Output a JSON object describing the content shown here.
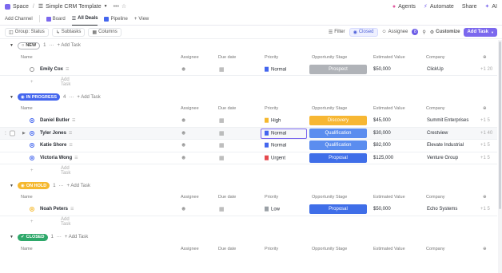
{
  "breadcrumb": {
    "space": "Space",
    "list": "Simple CRM Template",
    "more": "•••",
    "star": "☆"
  },
  "topbar": {
    "agents": "Agents",
    "automate": "Automate",
    "share": "Share",
    "ai": "AI"
  },
  "views": {
    "add_channel": "Add Channel",
    "board": "Board",
    "all_deals": "All Deals",
    "pipeline": "Pipeline",
    "add_view": "View"
  },
  "toolbar": {
    "group": "Group: Status",
    "subtasks": "Subtasks",
    "columns": "Columns",
    "filter": "Filter",
    "closed": "Closed",
    "assignee": "Assignee",
    "assignee_count": "8",
    "customize": "Customize",
    "add_task": "Add Task"
  },
  "columns": {
    "name": "Name",
    "assignee": "Assignee",
    "due": "Due date",
    "priority": "Priority",
    "stage": "Opportunity Stage",
    "estimated": "Estimated Value",
    "company": "Company"
  },
  "add_task_label": "Add Task",
  "colors": {
    "accent": "#7b68ee",
    "new": "#b0b3b8",
    "in_progress": "#4466ee",
    "on_hold": "#f5b82e",
    "closed": "#2ea86a"
  },
  "groups": [
    {
      "label": "NEW",
      "count": "1",
      "add": "+ Add Task",
      "rows": [
        {
          "name": "Emily Cox",
          "priority": "Normal",
          "stage": "Prospect",
          "estimated": "$50,000",
          "company": "ClickUp",
          "extra": "+1 20"
        }
      ]
    },
    {
      "label": "IN PROGRESS",
      "count": "4",
      "add": "+ Add Task",
      "rows": [
        {
          "name": "Daniel Butler",
          "priority": "High",
          "stage": "Discovery",
          "estimated": "$45,000",
          "company": "Summit Enterprises",
          "extra": "+1 5"
        },
        {
          "name": "Tyler Jones",
          "priority": "Normal",
          "stage": "Qualification",
          "estimated": "$30,000",
          "company": "Crestview",
          "extra": "+1 40"
        },
        {
          "name": "Katie Shore",
          "priority": "Normal",
          "stage": "Qualification",
          "estimated": "$82,000",
          "company": "Elevate Industrial",
          "extra": "+1 5"
        },
        {
          "name": "Victoria Wong",
          "priority": "Urgent",
          "stage": "Proposal",
          "estimated": "$125,000",
          "company": "Venture Group",
          "extra": "+1 5"
        }
      ]
    },
    {
      "label": "ON HOLD",
      "count": "1",
      "add": "+ Add Task",
      "rows": [
        {
          "name": "Noah Peters",
          "priority": "Low",
          "stage": "Proposal",
          "estimated": "$50,000",
          "company": "Echo Systems",
          "extra": "+1 5"
        }
      ]
    },
    {
      "label": "CLOSED",
      "count": "1",
      "add": "+ Add Task",
      "rows": []
    }
  ]
}
